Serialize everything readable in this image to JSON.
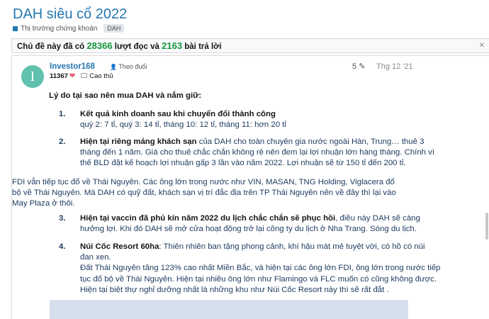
{
  "thread": {
    "title": "DAH siêu cổ 2022",
    "forum": "Thị trường chứng khoán",
    "tag": "DAH"
  },
  "stats": {
    "prefix": "Chủ đề này đã có",
    "views": "28366",
    "mid": "lượt đọc và",
    "replies": "2163",
    "suffix": "bài trả lời"
  },
  "post": {
    "avatar_letter": "I",
    "username": "Investor168",
    "follow_label": "Theo đuổi",
    "reaction_count": "11367",
    "rank": "Cao thủ",
    "post_number": "5",
    "date": "Thg 12 '21",
    "heading": "Lý do tại sao nên mua DAH và nắm giữ:",
    "item1": {
      "num": "1.",
      "title": "Kết quả kinh doanh sau khi chuyển đổi thành công",
      "line2": "quý 2: 7 tỉ, quý 3: 14 tỉ, tháng 10: 12 tỉ, tháng 11: hơn 20 tỉ"
    },
    "item2": {
      "num": "2.",
      "title": "Hiện tại riêng mảng khách sạn",
      "l1": "của DAH cho toàn chuyên gia nước ngoài Hàn, Trung… thuê 3",
      "l2": "tháng đến 1 năm. Giá cho thuê chắc chắn không rẻ nên đem lại lợi nhuận lớn hàng tháng. Chính vì",
      "l3": "thế BLD đặt kế hoạch lợi nhuận gấp 3 lần vào năm 2022. Lợi nhuận sẽ từ 150 tỉ đến 200 tỉ."
    },
    "para": {
      "l1": "FDI vẫn tiếp tục đổ về Thái Nguyên. Các ông lớn trong nước như VIN, MASAN, TNG Holding, Viglacera đổ",
      "l2": "bộ về Thái Nguyên. Mà DAH có quỹ đất, khách sạn vị trí đắc địa trên TP Thái Nguyên nên về đây thì lại vào",
      "l3": "May Plaza ở thôi."
    },
    "item3": {
      "num": "3.",
      "title": "Hiện tại vaccin đã phủ kín năm 2022 du lịch chắc chắn sẽ phục hồi",
      "l1": ", điều này DAH sẽ càng",
      "l2": "hưởng lợi. Khi đó DAH sẽ mở cửa hoạt động trở lại công ty du lịch ở Nha Trang. Sóng du lịch."
    },
    "item4": {
      "num": "4.",
      "title": "Núi Cốc Resort 60ha",
      "l1": ": Thiên nhiên ban tặng phong cảnh, khí hậu mát mẻ tuyệt vời, có hồ có núi",
      "l2": "đan xen.",
      "l3": "Đất Thái Nguyên tăng 123% cao nhất Miền Bắc, và hiện tại các ông lớn FDI, ông lớn trong nước tiếp",
      "l4": "tục đổ bộ về Thái Nguyên. Hiện tại nhiều ông lớn như Flamingo và FLC muốn có cũng không được.",
      "l5": "Hiện tại biệt thự nghỉ dưỡng nhất là những khu như Núi Cốc Resort này thì sẽ rất đắt ."
    }
  }
}
